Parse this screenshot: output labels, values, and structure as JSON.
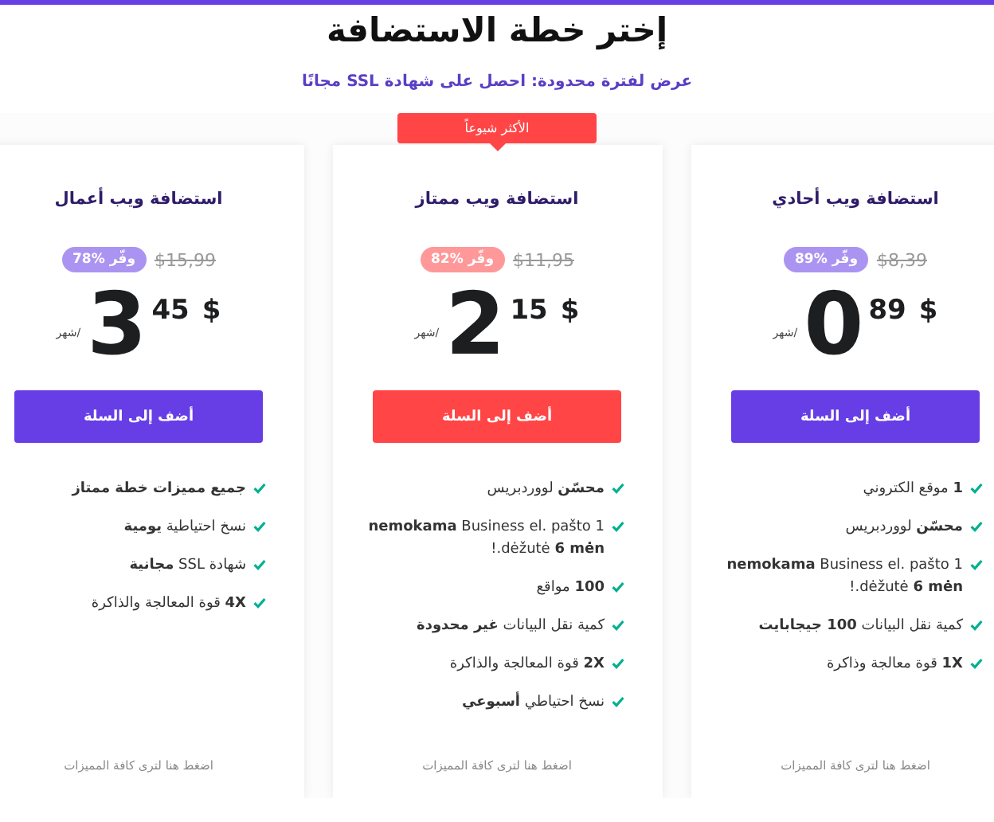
{
  "header": {
    "title": "إختر خطة الاستضافة",
    "subtitle": "عرض لفترة محدودة: احصل على شهادة **SSL** مجانًا"
  },
  "plans": [
    {
      "name": "استضافة ويب أحادي",
      "featured": false,
      "color": "#673de6",
      "old_price": "$8,39",
      "discount": "وفّر %89",
      "currency": "$",
      "whole": "0",
      "cents": "89",
      "period": "/شهر",
      "button": "أضف إلى السلة",
      "features": [
        "**1** موقع الكتروني",
        "**محسّن** لووردبريس",
        "**nemokama** Business el. pašto 1 dėžutė **6 mėn**.!",
        "كمية نقل البيانات **100 جيجابايت**",
        "**1X** قوة معالجة وذاكرة"
      ],
      "more_link": "اضغط هنا لترى كافة المميزات"
    },
    {
      "name": "استضافة ويب ممتاز",
      "featured": true,
      "badge": "الأكثر شيوعاً",
      "color": "#ff4546",
      "old_price": "$11,95",
      "discount": "وفّر %82",
      "currency": "$",
      "whole": "2",
      "cents": "15",
      "period": "/شهر",
      "button": "أضف إلى السلة",
      "features": [
        "**محسّن** لووردبريس",
        "**nemokama** Business el. pašto 1 dėžutė **6 mėn**.!",
        "**100** مواقع",
        "كمية نقل البيانات **غير محدودة**",
        "**2X** قوة المعالجة والذاكرة",
        "نسخ احتياطي **أسبوعي**"
      ],
      "more_link": "اضغط هنا لترى كافة المميزات"
    },
    {
      "name": "استضافة ويب أعمال",
      "featured": false,
      "color": "#673de6",
      "old_price": "$15,99",
      "discount": "وفّر %78",
      "currency": "$",
      "whole": "3",
      "cents": "45",
      "period": "/شهر",
      "button": "أضف إلى السلة",
      "features": [
        "**جميع مميزات خطة ممتاز**",
        "نسخ احتياطية **يومية**",
        "شهادة SSL **مجانية**",
        "**4X** قوة المعالجة والذاكرة"
      ],
      "more_link": "اضغط هنا لترى كافة المميزات"
    }
  ]
}
